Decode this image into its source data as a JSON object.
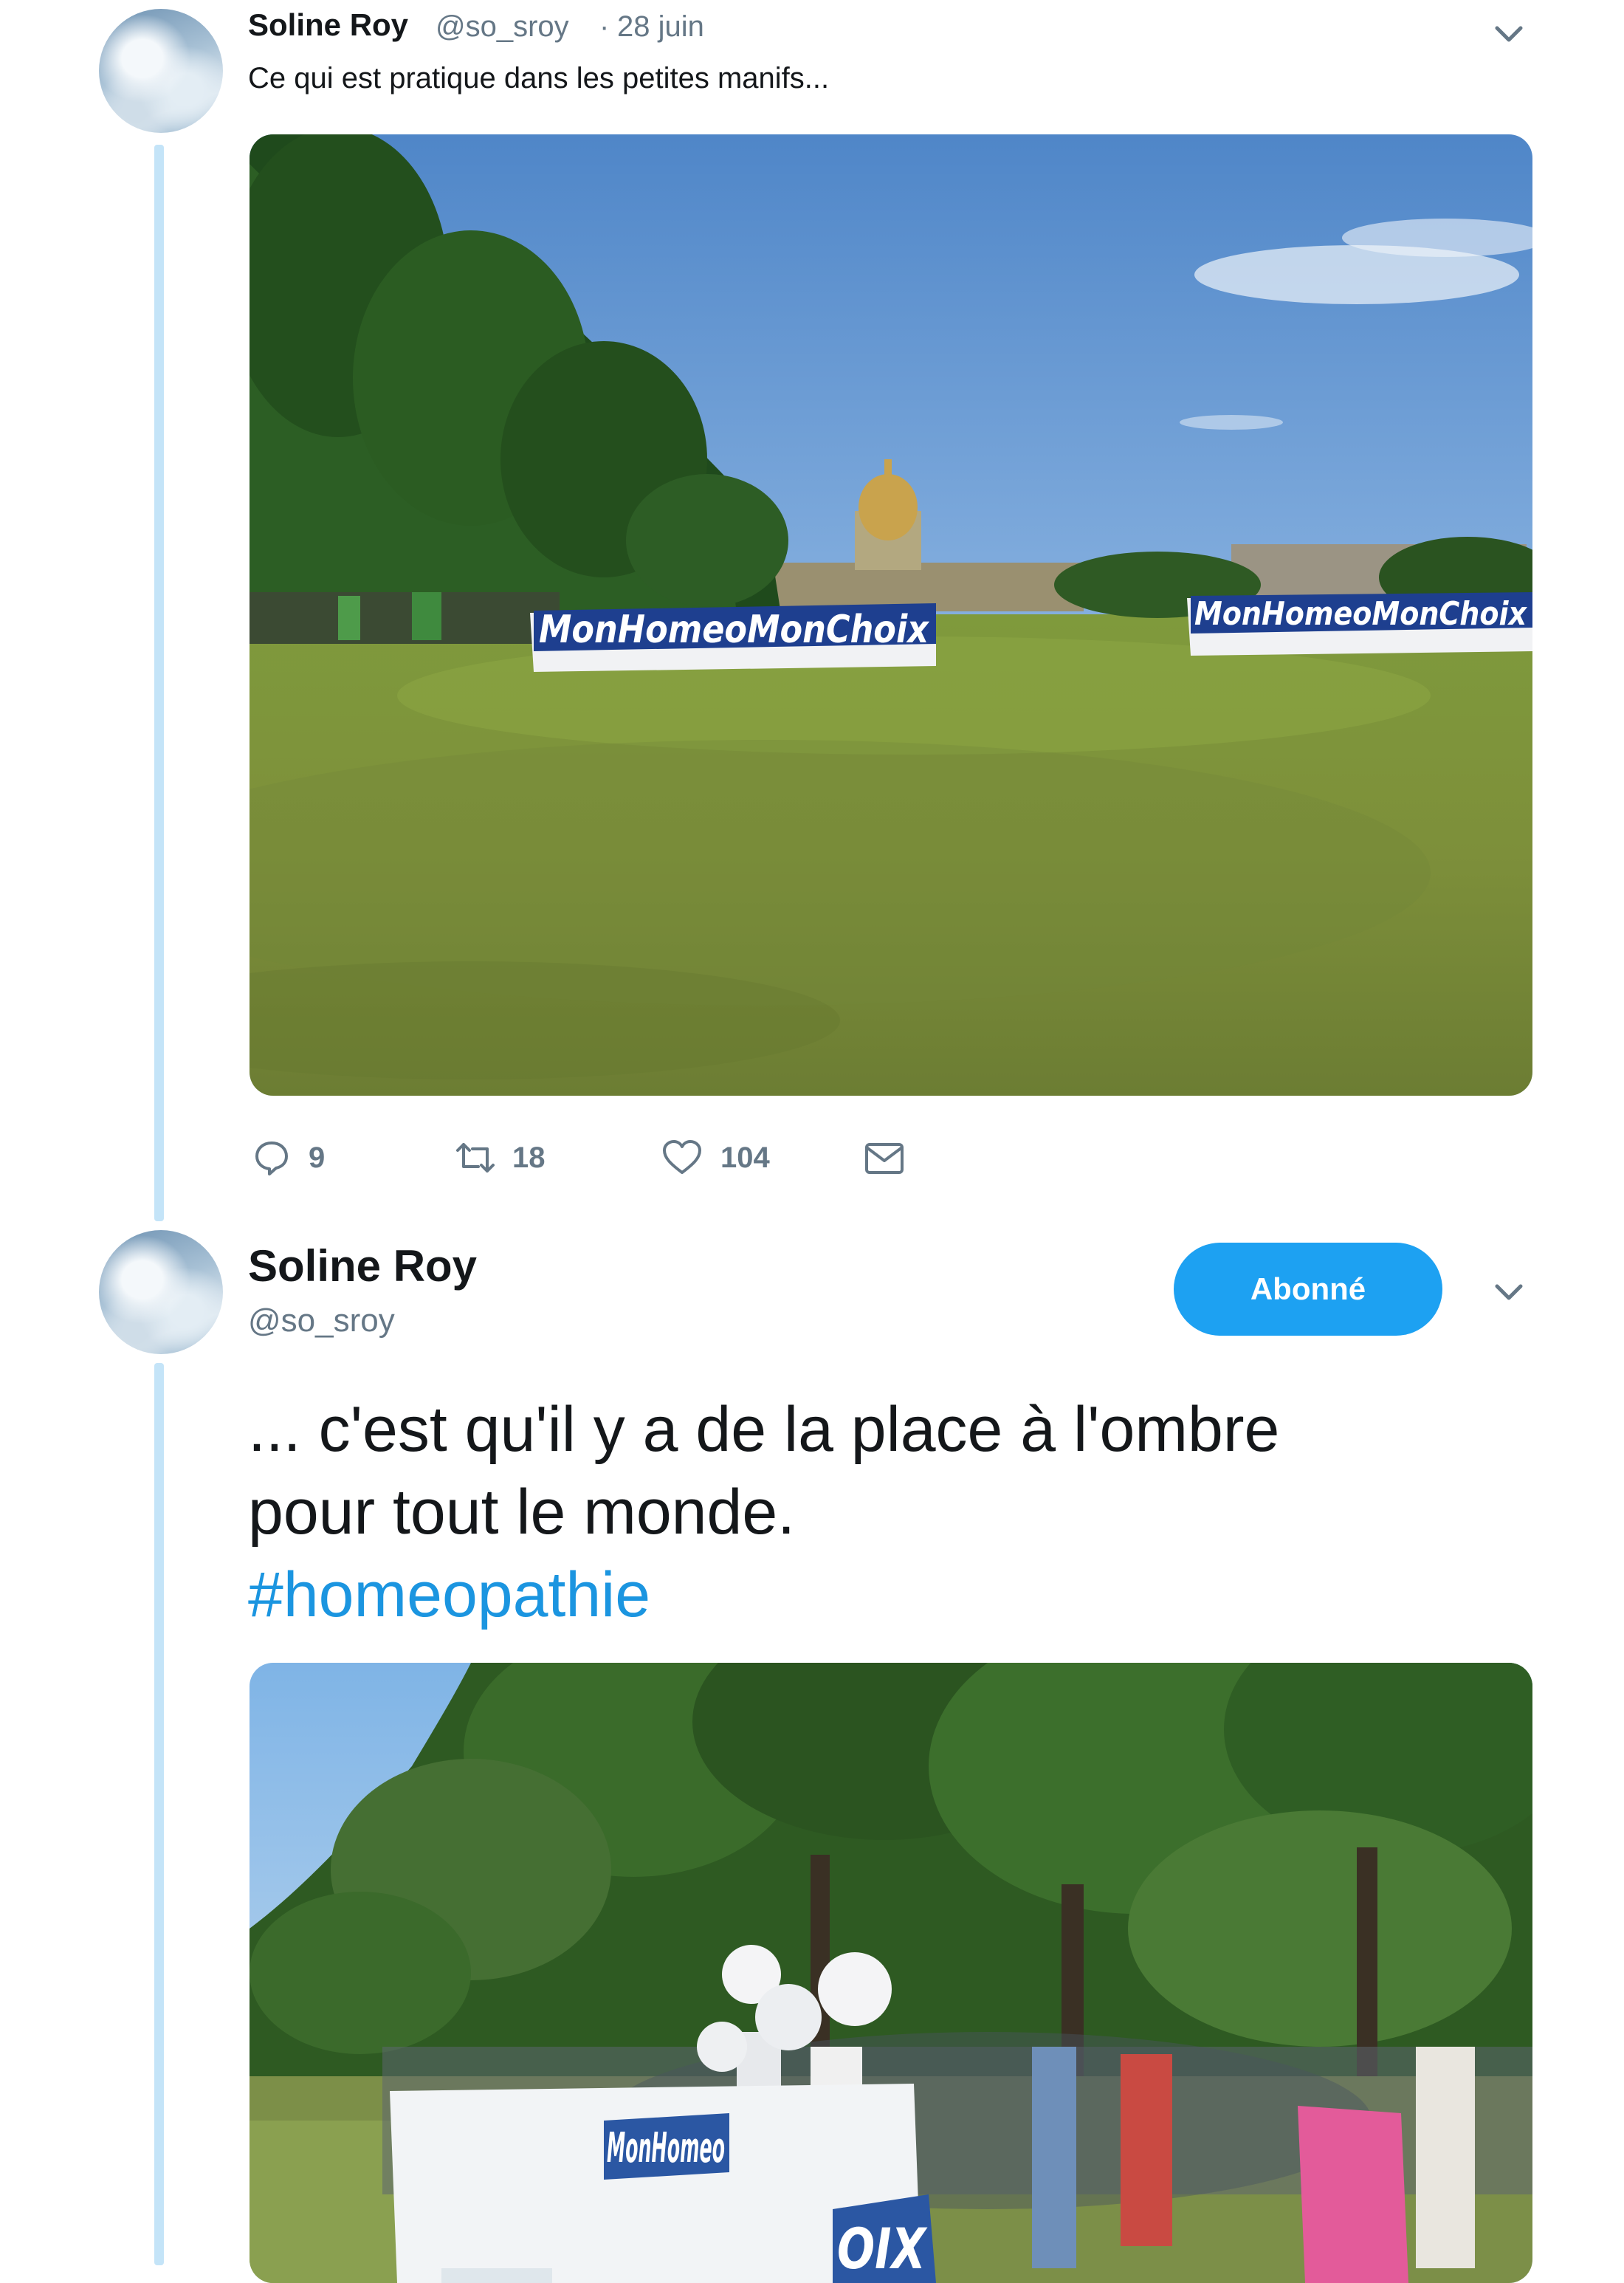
{
  "tweet1": {
    "author_name": "Soline Roy",
    "handle": "@so_sroy",
    "separator": "·",
    "date": "28 juin",
    "text": "Ce qui est pratique dans les petites manifs...",
    "image": {
      "sign_left": "MonHomeoMonChoix",
      "sign_right": "MonHomeoMonChoix"
    },
    "actions": {
      "replies": "9",
      "retweets": "18",
      "likes": "104"
    }
  },
  "tweet2": {
    "author_name": "Soline Roy",
    "handle": "@so_sroy",
    "follow_label": "Abonné",
    "text_line1": "... c'est qu'il y a de la place à l'ombre",
    "text_line2": "pour tout le monde.",
    "hashtag": "#homeopathie",
    "image": {
      "sign_text": "MonHomeo",
      "sign_tail": "OIX"
    }
  },
  "colors": {
    "accent": "#1da1f2",
    "hashtag": "#1b95e0",
    "muted": "#657786",
    "thread_line": "#c4e4f8",
    "text": "#14171a"
  },
  "icons": {
    "caret": "chevron-down-icon",
    "reply": "reply-icon",
    "retweet": "retweet-icon",
    "like": "heart-icon",
    "dm": "envelope-icon"
  }
}
